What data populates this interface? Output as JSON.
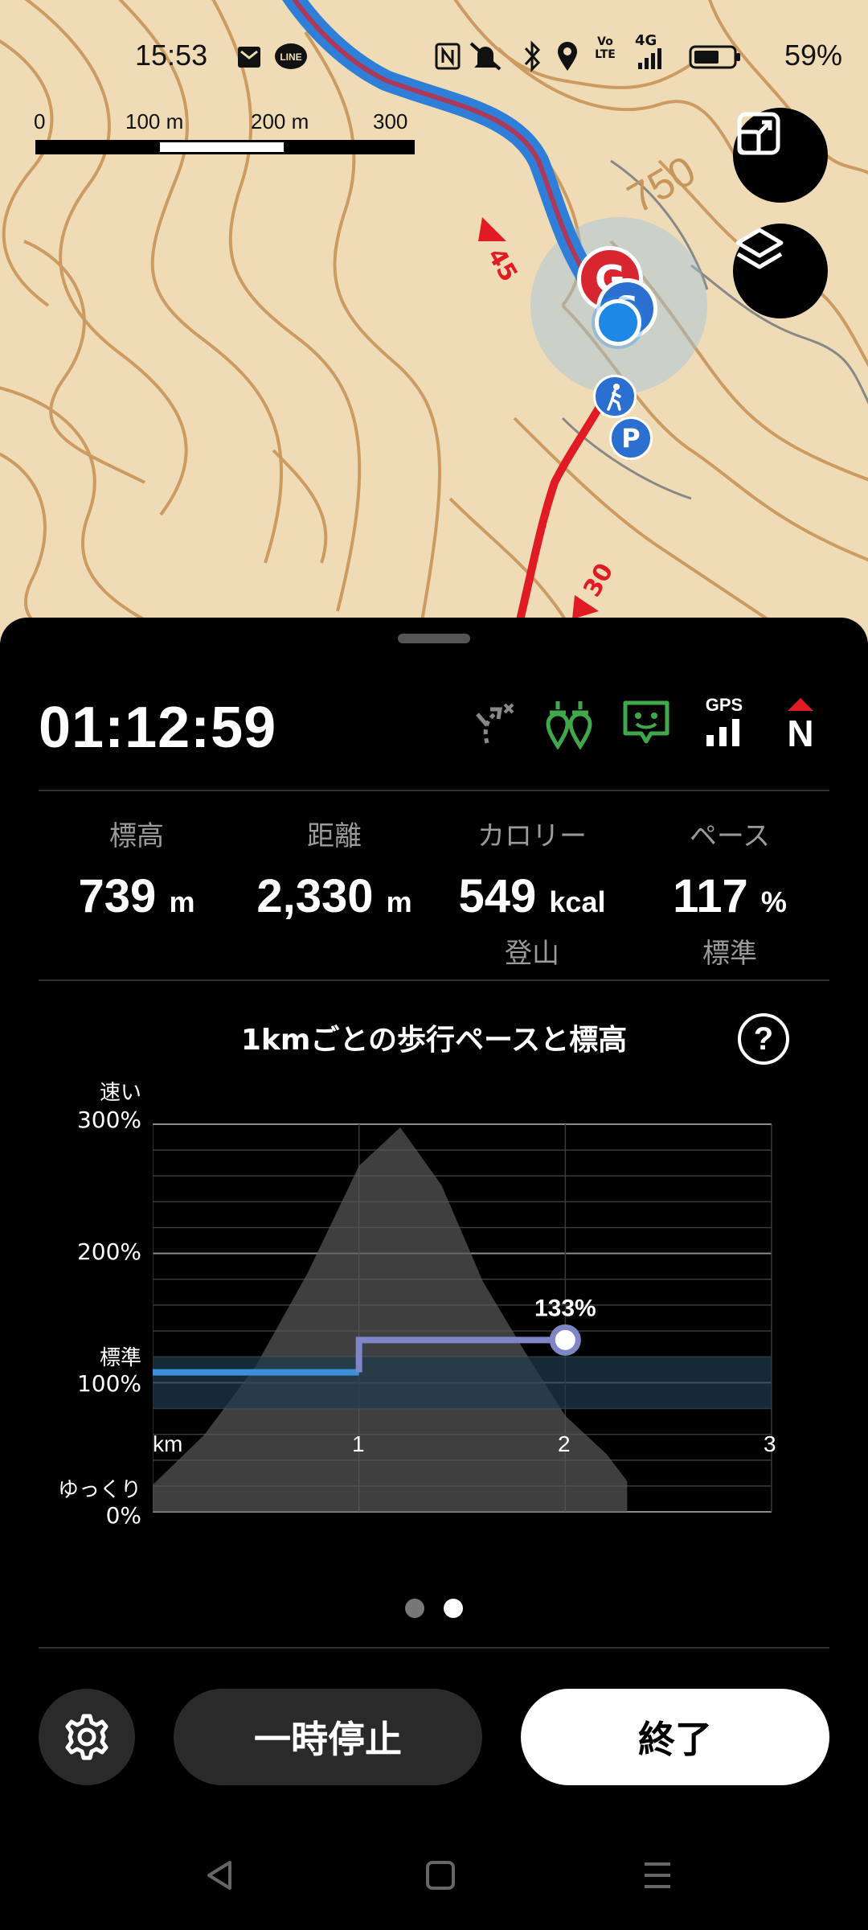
{
  "status_bar": {
    "time": "15:53",
    "battery_percent": "59%",
    "network": "4G",
    "volte": "Vo LTE"
  },
  "map": {
    "scale_labels": [
      "0",
      "100 m",
      "200 m",
      "300 m"
    ],
    "contour_label": "750",
    "route_marker_labels": [
      "45",
      "30"
    ],
    "goal_marker": "G",
    "start_marker": "S",
    "parking_marker": "P",
    "colors": {
      "terrain": "#efdcb6",
      "contour": "#c8955a",
      "track": "#2f7fd8",
      "route": "#e01b24"
    }
  },
  "session": {
    "elapsed_time": "01:12:59",
    "gps_label": "GPS",
    "north_label": "N"
  },
  "stats": [
    {
      "label": "標高",
      "value": "739",
      "unit": "m",
      "sub": ""
    },
    {
      "label": "距離",
      "value": "2,330",
      "unit": "m",
      "sub": ""
    },
    {
      "label": "カロリー",
      "value": "549",
      "unit": "kcal",
      "sub": "登山"
    },
    {
      "label": "ペース",
      "value": "117",
      "unit": "%",
      "sub": "標準"
    }
  ],
  "chart_section": {
    "title": "1kmごとの歩行ペースと標高",
    "help_label": "?"
  },
  "chart_data": {
    "type": "line",
    "x_unit_label": "km",
    "x_ticks": [
      "1",
      "2",
      "3"
    ],
    "xlim": [
      0,
      3
    ],
    "y_ticks": [
      "300%",
      "200%",
      "100%",
      "0%"
    ],
    "y_annotations": [
      "速い",
      "標準",
      "ゆっくり"
    ],
    "ylim": [
      0,
      300
    ],
    "pace_series": {
      "x": [
        0,
        1,
        1,
        2
      ],
      "y": [
        108,
        108,
        133,
        133
      ]
    },
    "highlight_label": "133%",
    "standard_band": [
      80,
      120
    ],
    "elevation_profile": {
      "x": [
        0,
        0.25,
        0.5,
        0.75,
        1.0,
        1.2,
        1.4,
        1.6,
        1.8,
        2.0,
        2.2,
        2.3
      ],
      "relative_height": [
        0.07,
        0.2,
        0.38,
        0.62,
        0.9,
        1.0,
        0.85,
        0.6,
        0.42,
        0.25,
        0.15,
        0.08
      ]
    },
    "grid": true,
    "colors": {
      "pace_segment_1": "#3d8fd9",
      "pace_segment_2": "#7f86c8",
      "band": "#1e3a4d",
      "elevation": "#5a5a5a"
    }
  },
  "pager": {
    "active_index": 1,
    "count": 2
  },
  "buttons": {
    "settings_icon": "gear-icon",
    "pause": "一時停止",
    "end": "終了"
  }
}
